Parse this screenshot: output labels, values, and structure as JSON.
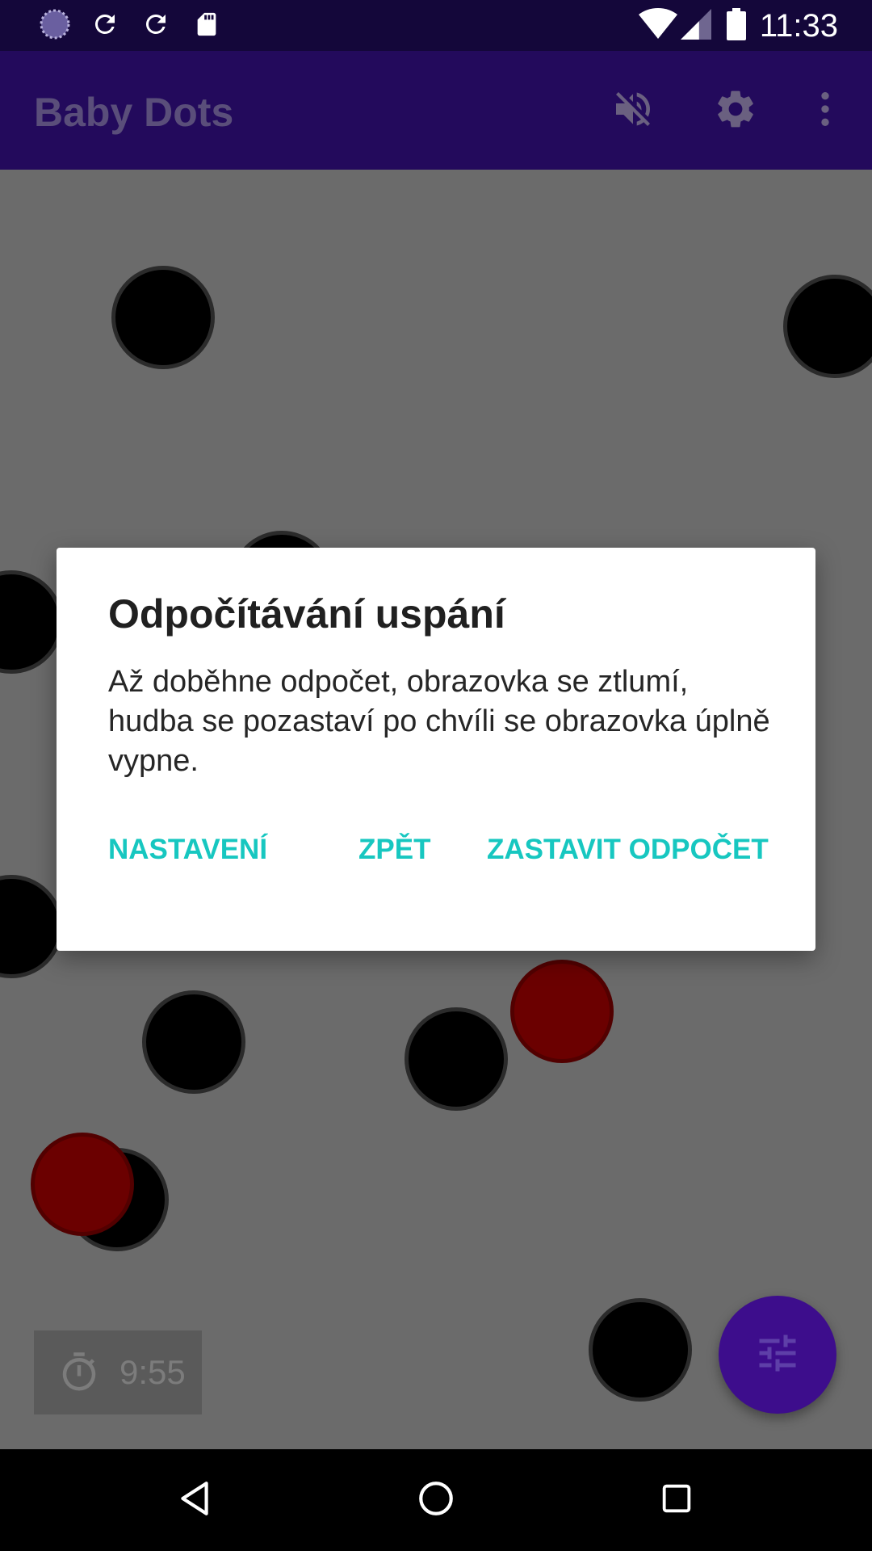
{
  "status_bar": {
    "time": "11:33",
    "icons": [
      "loading-icon",
      "sync-icon",
      "sync-icon",
      "sd-card-icon",
      "wifi-icon",
      "signal-icon",
      "battery-icon"
    ]
  },
  "app_bar": {
    "title": "Baby Dots",
    "actions": [
      "mute-icon",
      "gear-icon",
      "more-vert-icon"
    ]
  },
  "canvas": {
    "dot_colors": {
      "black": "#000000",
      "red": "#6b0000"
    }
  },
  "timer": {
    "value": "9:55",
    "icon": "timer-icon"
  },
  "fab": {
    "icon": "tune-icon"
  },
  "dialog": {
    "title": "Odpočítávání uspání",
    "message": "Až doběhne odpočet, obrazovka se ztlumí, hudba se pozastaví po chvíli se obrazovka úplně vypne.",
    "buttons": {
      "settings": "NASTAVENÍ",
      "back": "ZPĚT",
      "stop": "ZASTAVIT ODPOČET"
    },
    "accent_color": "#17c7c0"
  },
  "nav_bar": {
    "buttons": [
      "back-icon",
      "home-icon",
      "recents-icon"
    ]
  },
  "colors": {
    "status_bar": "#14073a",
    "app_bar": "#230a5c",
    "fab": "#3d0d8c",
    "canvas": "#6b6b6b"
  }
}
